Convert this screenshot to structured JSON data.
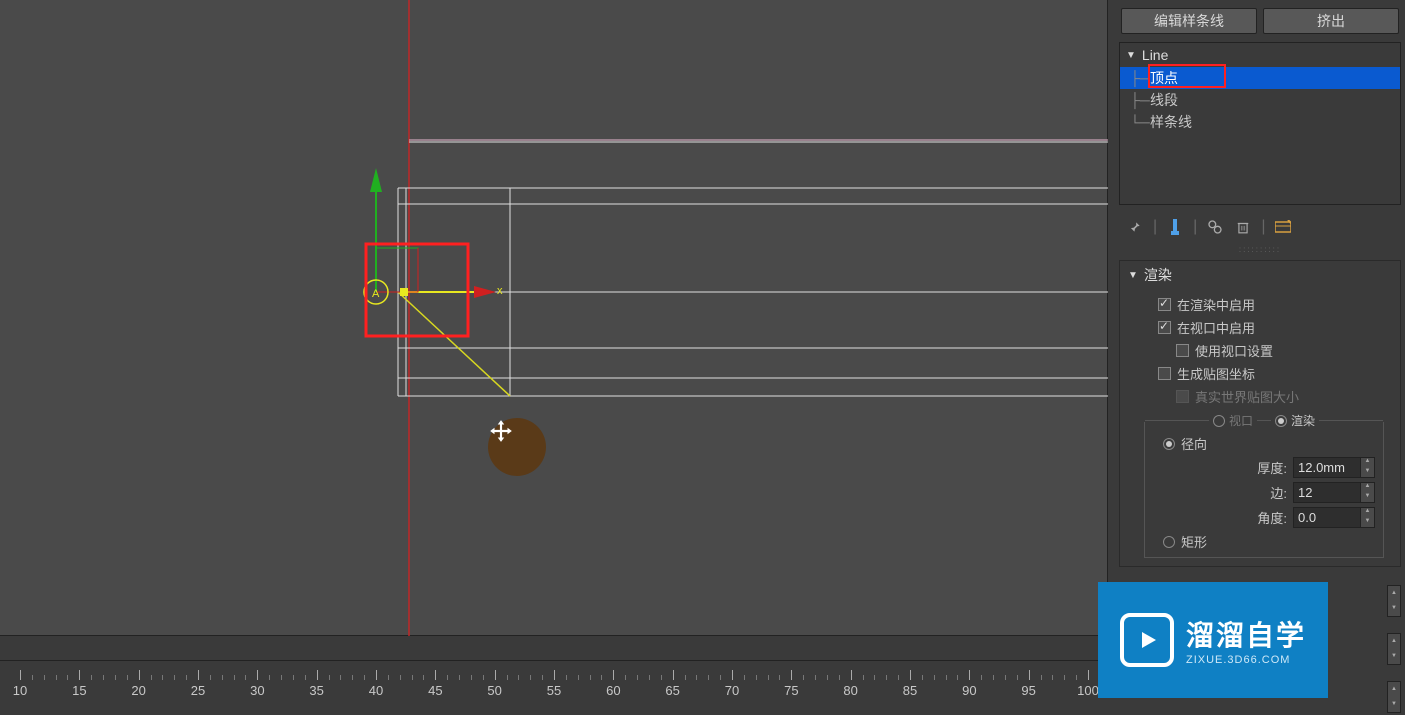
{
  "tabs": {
    "edit_spline": "编辑样条线",
    "extrude": "挤出"
  },
  "modifier_stack": {
    "root": "Line",
    "items": [
      "顶点",
      "线段",
      "样条线"
    ],
    "selected_index": 0
  },
  "iconbar": {
    "pin": "pin-icon",
    "i1": "flask-icon",
    "i2": "curve-edit-icon",
    "i3": "trash-icon",
    "i4": "configure-icon"
  },
  "rollout_render": {
    "title": "渲染",
    "enable_in_render": "在渲染中启用",
    "enable_in_viewport": "在视口中启用",
    "use_viewport_settings": "使用视口设置",
    "generate_mapping": "生成贴图坐标",
    "real_world_size": "真实世界贴图大小",
    "viewport_label": "视口",
    "render_label": "渲染",
    "radial": "径向",
    "thickness_label": "厚度:",
    "thickness_value": "12.0mm",
    "sides_label": "边:",
    "sides_value": "12",
    "angle_label": "角度:",
    "angle_value": "0.0",
    "rectangular": "矩形"
  },
  "checks": {
    "enable_in_render": true,
    "enable_in_viewport": true,
    "use_viewport_settings": false,
    "generate_mapping": false,
    "real_world_size": false
  },
  "radios": {
    "view_render": "render",
    "shape": "radial"
  },
  "gizmo": {
    "x_label": "x",
    "y_label": "A"
  },
  "timeline": {
    "start": 10,
    "end": 100,
    "step": 5
  },
  "watermark": {
    "title": "溜溜自学",
    "url": "ZIXUE.3D66.COM"
  }
}
